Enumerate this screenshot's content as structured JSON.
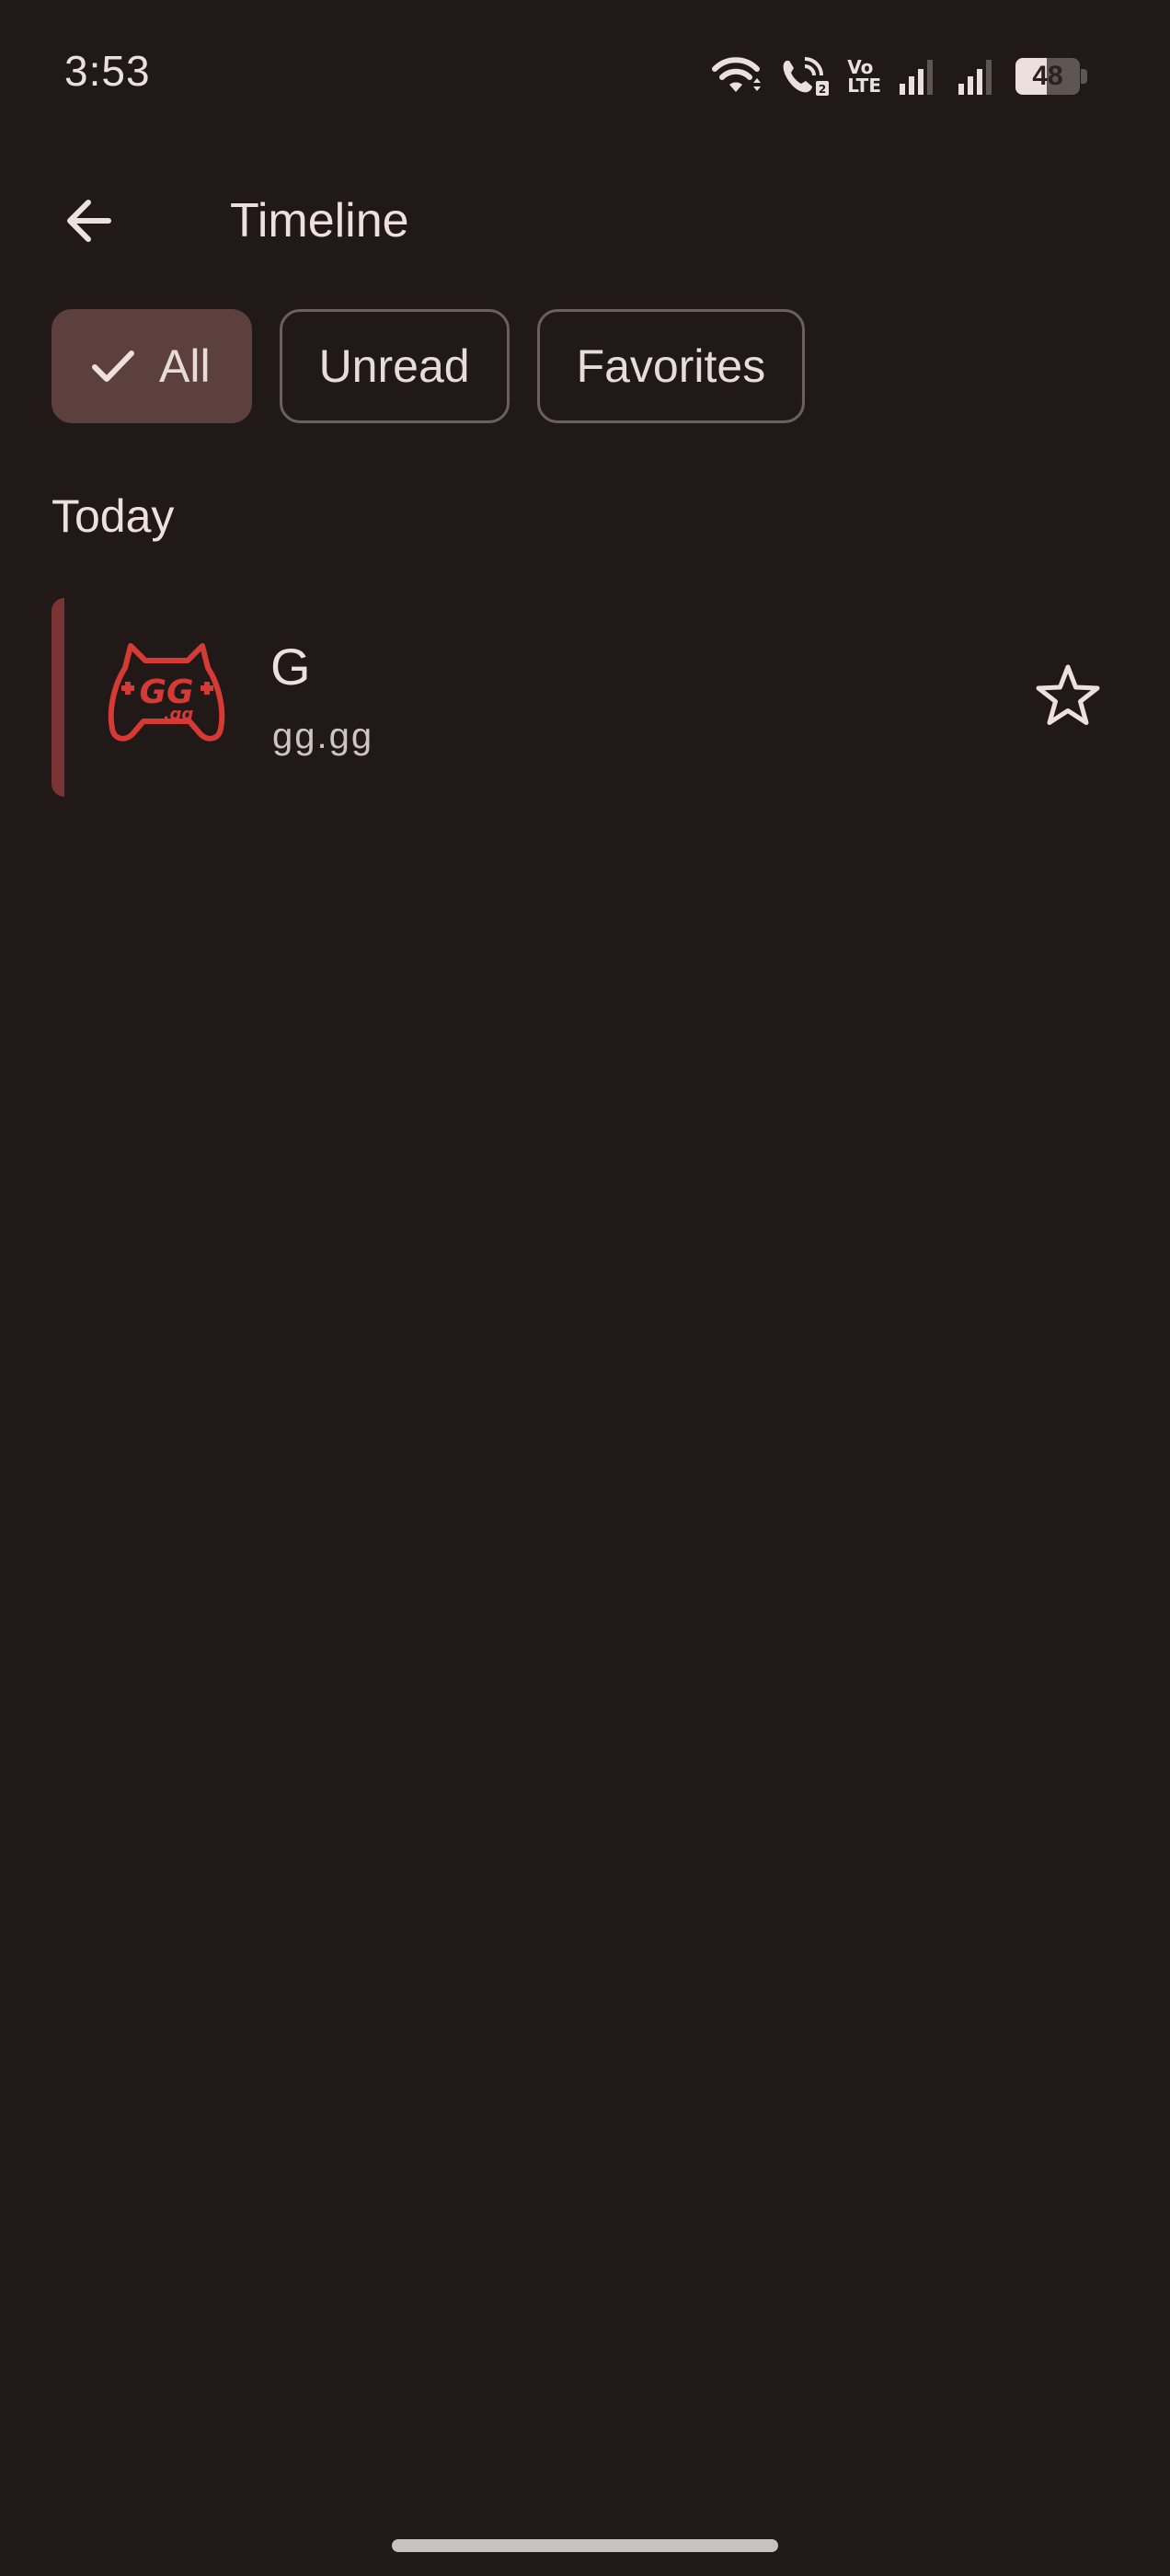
{
  "status_bar": {
    "time": "3:53",
    "icons": [
      "wifi-icon",
      "wifi-calling-icon",
      "volte-icon",
      "signal-icon-sim1",
      "signal-icon-sim2",
      "battery-icon"
    ],
    "volte_top": "Vo",
    "volte_bottom": "LTE",
    "battery_level": "48",
    "battery_fraction": 0.48
  },
  "app_bar": {
    "back_icon": "arrow-back-icon",
    "title": "Timeline"
  },
  "filters": {
    "all": "All",
    "unread": "Unread",
    "favorites": "Favorites",
    "selected": "all",
    "selected_icon": "check-icon"
  },
  "sections": [
    {
      "header": "Today",
      "items": [
        {
          "title": "G",
          "subtitle": "gg.gg",
          "logo": "gg-gamepad-logo",
          "favorite_icon": "star-outline-icon"
        }
      ]
    }
  ],
  "colors": {
    "background": "#211918",
    "selected_chip": "#5b403e",
    "accent_bar": "#7a3433",
    "logo_red": "#d53a35",
    "text": "#eee0dd"
  }
}
